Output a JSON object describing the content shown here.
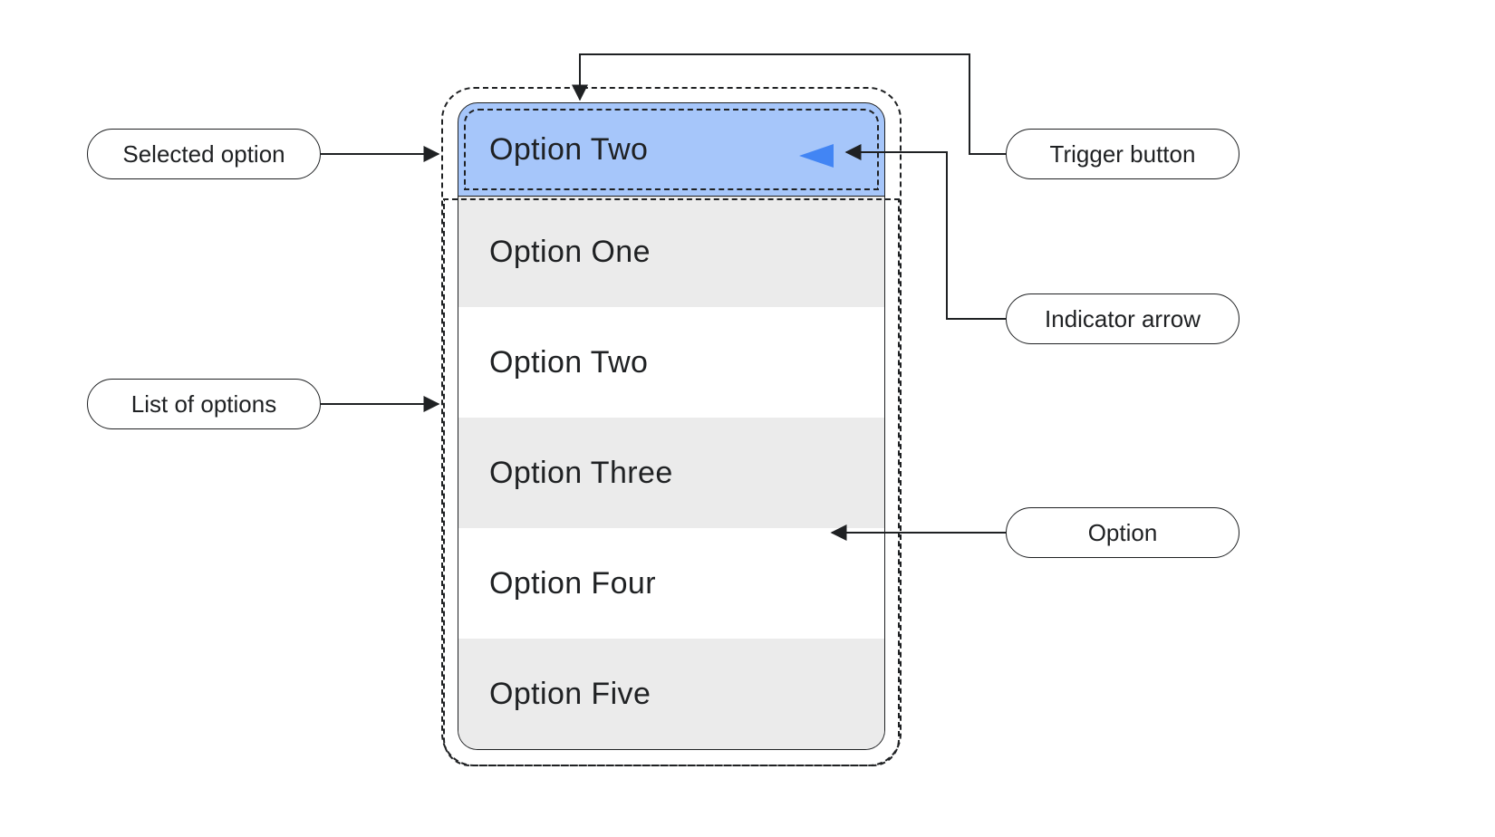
{
  "component": {
    "selected": "Option Two",
    "options": [
      "Option One",
      "Option Two",
      "Option Three",
      "Option  Four",
      "Option Five"
    ],
    "trigger_fill": "#a6c6fa",
    "indicator_arrow_fill": "#4285f4"
  },
  "callouts": {
    "selected_option": "Selected option",
    "list_of_options": "List of options",
    "trigger_button": "Trigger button",
    "indicator_arrow": "Indicator arrow",
    "option": "Option"
  }
}
